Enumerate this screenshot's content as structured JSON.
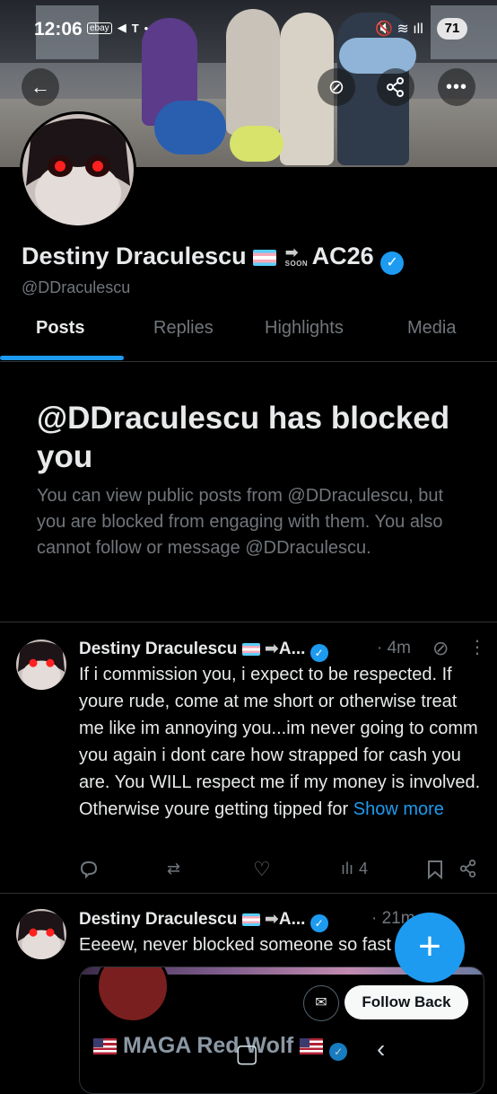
{
  "status_bar": {
    "time": "12:06",
    "icons": [
      "ebay-icon",
      "telegram-icon",
      "tmobile-icon",
      "dot-icon"
    ],
    "ebay_label": "ebay",
    "battery": "71"
  },
  "profile": {
    "display_name": "Destiny Draculescu",
    "name_suffix": "AC26",
    "soon_label": "SOON",
    "handle": "@DDraculescu"
  },
  "tabs": [
    {
      "label": "Posts",
      "active": true
    },
    {
      "label": "Replies",
      "active": false
    },
    {
      "label": "Highlights",
      "active": false
    },
    {
      "label": "Media",
      "active": false
    }
  ],
  "blocked": {
    "title": "@DDraculescu has blocked you",
    "description": "You can view public posts from @DDraculescu, but you are blocked from engaging with them. You also cannot follow or message @DDraculescu."
  },
  "posts": [
    {
      "name": "Destiny Draculescu",
      "name_suffix": "A...",
      "time": "· 4m",
      "text": "If i commission you, i expect to be respected. If youre rude, come at me short or otherwise treat me like im annoying you...im never going to comm you again i dont care how strapped for cash you are. You WILL respect me if my money is involved. Otherwise youre getting tipped for",
      "show_more": "Show more",
      "views": "4"
    },
    {
      "name": "Destiny Draculescu",
      "name_suffix": "A...",
      "time": "· 21m",
      "text": "Eeeew, never blocked someone so fast"
    }
  ],
  "quote": {
    "follow_back": "Follow Back",
    "name": "MAGA Red Wolf"
  }
}
